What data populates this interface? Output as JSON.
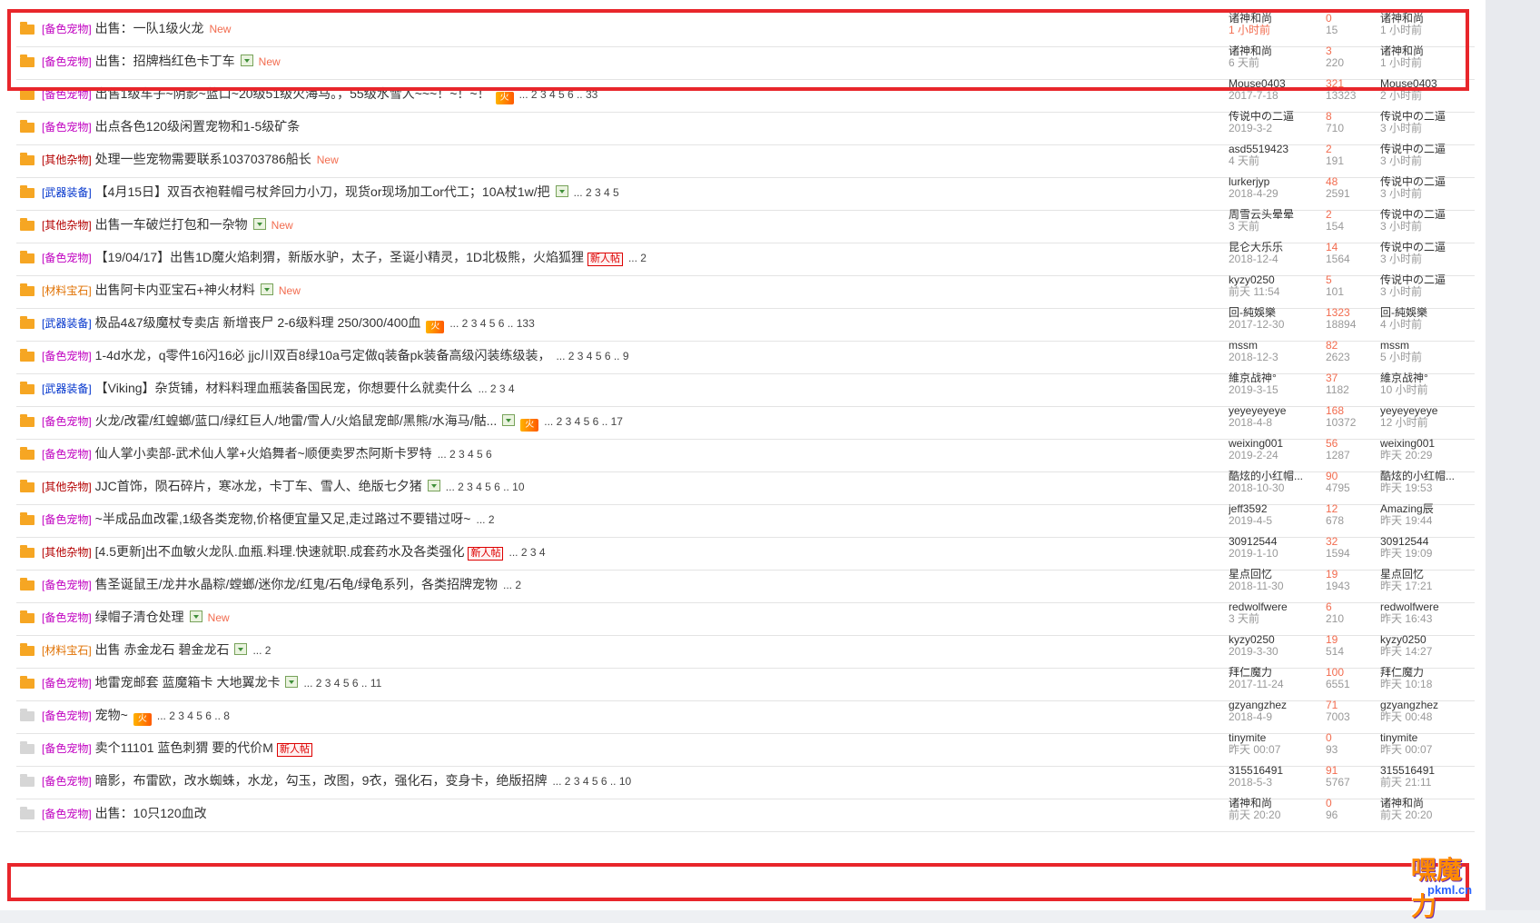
{
  "rows": [
    {
      "icon": "hot",
      "cat": "[备色宠物]",
      "catColor": "#c000c0",
      "title": "出售：一队1级火龙",
      "img": false,
      "hot": false,
      "newbie": false,
      "isNew": true,
      "pages": "",
      "a1": "诸神和尚",
      "a1s": "1 小时前",
      "a1red": true,
      "r": "0",
      "v": "15",
      "a2": "诸神和尚",
      "a2s": "1 小时前"
    },
    {
      "icon": "hot",
      "cat": "[备色宠物]",
      "catColor": "#c000c0",
      "title": "出售：招牌档红色卡丁车",
      "img": true,
      "hot": false,
      "newbie": false,
      "isNew": true,
      "pages": "",
      "a1": "诸神和尚",
      "a1s": "6 天前",
      "a1red": false,
      "r": "3",
      "v": "220",
      "a2": "诸神和尚",
      "a2s": "1 小时前"
    },
    {
      "icon": "hot",
      "cat": "[备色宠物]",
      "catColor": "#c000c0",
      "title": "出售1级车子~阴影~蓝口~20级51级火海马。，55级水雪人~~~！~！~！",
      "img": false,
      "hot": true,
      "newbie": false,
      "isNew": false,
      "pages": "... 2 3 4 5 6 .. 33",
      "a1": "Mouse0403",
      "a1s": "2017-7-18",
      "a1red": false,
      "r": "321",
      "v": "13323",
      "a2": "Mouse0403",
      "a2s": "2 小时前"
    },
    {
      "icon": "hot",
      "cat": "[备色宠物]",
      "catColor": "#c000c0",
      "title": "出点各色120级闲置宠物和1-5级矿条",
      "img": false,
      "hot": false,
      "newbie": false,
      "isNew": false,
      "pages": "",
      "a1": "传说中の二逼",
      "a1s": "2019-3-2",
      "a1red": false,
      "r": "8",
      "v": "710",
      "a2": "传说中の二逼",
      "a2s": "3 小时前"
    },
    {
      "icon": "hot",
      "cat": "[其他杂物]",
      "catColor": "#b40000",
      "title": "处理一些宠物需要联系103703786船长",
      "img": false,
      "hot": false,
      "newbie": false,
      "isNew": true,
      "pages": "",
      "a1": "asd5519423",
      "a1s": "4 天前",
      "a1red": false,
      "r": "2",
      "v": "191",
      "a2": "传说中の二逼",
      "a2s": "3 小时前"
    },
    {
      "icon": "hot",
      "cat": "[武器装备]",
      "catColor": "#0033cc",
      "title": "【4月15日】双百衣袍鞋帽弓杖斧回力小刀，现货or现场加工or代工；10A杖1w/把",
      "img": true,
      "hot": false,
      "newbie": false,
      "isNew": false,
      "pages": "... 2 3 4 5",
      "a1": "lurkerjyp",
      "a1s": "2018-4-29",
      "a1red": false,
      "r": "48",
      "v": "2591",
      "a2": "传说中の二逼",
      "a2s": "3 小时前"
    },
    {
      "icon": "hot",
      "cat": "[其他杂物]",
      "catColor": "#b40000",
      "title": "出售一车破烂打包和一杂物",
      "img": true,
      "hot": false,
      "newbie": false,
      "isNew": true,
      "pages": "",
      "a1": "周雪云头晕晕",
      "a1s": "3 天前",
      "a1red": false,
      "r": "2",
      "v": "154",
      "a2": "传说中の二逼",
      "a2s": "3 小时前"
    },
    {
      "icon": "hot",
      "cat": "[备色宠物]",
      "catColor": "#c000c0",
      "title": "【19/04/17】出售1D魔火焰刺猬，新版水驴，太子，圣诞小精灵，1D北极熊，火焰狐狸",
      "img": false,
      "hot": false,
      "newbie": true,
      "isNew": false,
      "pages": "... 2",
      "a1": "昆仑大乐乐",
      "a1s": "2018-12-4",
      "a1red": false,
      "r": "14",
      "v": "1564",
      "a2": "传说中の二逼",
      "a2s": "3 小时前"
    },
    {
      "icon": "hot",
      "cat": "[材料宝石]",
      "catColor": "#e07000",
      "title": "出售阿卡内亚宝石+神火材料",
      "img": true,
      "hot": false,
      "newbie": false,
      "isNew": true,
      "pages": "",
      "a1": "kyzy0250",
      "a1s": "前天 11:54",
      "a1red": false,
      "r": "5",
      "v": "101",
      "a2": "传说中の二逼",
      "a2s": "3 小时前"
    },
    {
      "icon": "hot",
      "cat": "[武器装备]",
      "catColor": "#0033cc",
      "title": "极品4&7级魔杖专卖店 新增丧尸 2-6级料理 250/300/400血",
      "img": false,
      "hot": true,
      "newbie": false,
      "isNew": false,
      "pages": "... 2 3 4 5 6 .. 133",
      "a1": "回-純娛樂",
      "a1s": "2017-12-30",
      "a1red": false,
      "r": "1323",
      "v": "18894",
      "a2": "回-純娛樂",
      "a2s": "4 小时前"
    },
    {
      "icon": "hot",
      "cat": "[备色宠物]",
      "catColor": "#c000c0",
      "title": "1-4d水龙，q零件16闪16必 jjc川双百8绿10a弓定做q装备pk装备高级闪装练级装，",
      "img": false,
      "hot": false,
      "newbie": false,
      "isNew": false,
      "pages": "... 2 3 4 5 6 .. 9",
      "a1": "mssm",
      "a1s": "2018-12-3",
      "a1red": false,
      "r": "82",
      "v": "2623",
      "a2": "mssm",
      "a2s": "5 小时前"
    },
    {
      "icon": "hot",
      "cat": "[武器装备]",
      "catColor": "#0033cc",
      "title": "【Viking】杂货铺，材料料理血瓶装备国民宠，你想要什么就卖什么",
      "img": false,
      "hot": false,
      "newbie": false,
      "isNew": false,
      "pages": "... 2 3 4",
      "a1": "維京战神°",
      "a1s": "2019-3-15",
      "a1red": false,
      "r": "37",
      "v": "1182",
      "a2": "維京战神°",
      "a2s": "10 小时前"
    },
    {
      "icon": "hot",
      "cat": "[备色宠物]",
      "catColor": "#c000c0",
      "title": "火龙/改霍/红蝗螂/蓝口/绿红巨人/地雷/雪人/火焰鼠宠邮/黑熊/水海马/骷...",
      "img": true,
      "hot": true,
      "newbie": false,
      "isNew": false,
      "pages": "... 2 3 4 5 6 .. 17",
      "a1": "yeyeyeyeye",
      "a1s": "2018-4-8",
      "a1red": false,
      "r": "168",
      "v": "10372",
      "a2": "yeyeyeyeye",
      "a2s": "12 小时前"
    },
    {
      "icon": "hot",
      "cat": "[备色宠物]",
      "catColor": "#c000c0",
      "title": "仙人掌小卖部-武术仙人掌+火焰舞者~顺便卖罗杰阿斯卡罗特",
      "img": false,
      "hot": false,
      "newbie": false,
      "isNew": false,
      "pages": "... 2 3 4 5 6",
      "a1": "weixing001",
      "a1s": "2019-2-24",
      "a1red": false,
      "r": "56",
      "v": "1287",
      "a2": "weixing001",
      "a2s": "昨天 20:29"
    },
    {
      "icon": "hot",
      "cat": "[其他杂物]",
      "catColor": "#b40000",
      "title": "JJC首饰，陨石碎片，寒冰龙，卡丁车、雪人、绝版七夕猪",
      "img": true,
      "hot": false,
      "newbie": false,
      "isNew": false,
      "pages": "... 2 3 4 5 6 .. 10",
      "a1": "酷炫的小红帽...",
      "a1s": "2018-10-30",
      "a1red": false,
      "r": "90",
      "v": "4795",
      "a2": "酷炫的小红帽...",
      "a2s": "昨天 19:53"
    },
    {
      "icon": "hot",
      "cat": "[备色宠物]",
      "catColor": "#c000c0",
      "title": "~半成品血改霍,1级各类宠物,价格便宜量又足,走过路过不要错过呀~",
      "img": false,
      "hot": false,
      "newbie": false,
      "isNew": false,
      "pages": "... 2",
      "a1": "jeff3592",
      "a1s": "2019-4-5",
      "a1red": false,
      "r": "12",
      "v": "678",
      "a2": "Amazing辰",
      "a2s": "昨天 19:44"
    },
    {
      "icon": "hot",
      "cat": "[其他杂物]",
      "catColor": "#b40000",
      "title": "[4.5更新]出不血敏火龙队.血瓶.料理.快速就职.成套药水及各类强化",
      "img": false,
      "hot": false,
      "newbie": true,
      "isNew": false,
      "pages": "... 2 3 4",
      "a1": "30912544",
      "a1s": "2019-1-10",
      "a1red": false,
      "r": "32",
      "v": "1594",
      "a2": "30912544",
      "a2s": "昨天 19:09"
    },
    {
      "icon": "hot",
      "cat": "[备色宠物]",
      "catColor": "#c000c0",
      "title": "售圣诞鼠王/龙井水晶粽/螳螂/迷你龙/红鬼/石龟/绿龟系列，各类招牌宠物",
      "img": false,
      "hot": false,
      "newbie": false,
      "isNew": false,
      "pages": "... 2",
      "a1": "星点回忆",
      "a1s": "2018-11-30",
      "a1red": false,
      "r": "19",
      "v": "1943",
      "a2": "星点回忆",
      "a2s": "昨天 17:21"
    },
    {
      "icon": "hot",
      "cat": "[备色宠物]",
      "catColor": "#c000c0",
      "title": "绿帽子清仓处理",
      "img": true,
      "hot": false,
      "newbie": false,
      "isNew": true,
      "pages": "",
      "a1": "redwolfwere",
      "a1s": "3 天前",
      "a1red": false,
      "r": "6",
      "v": "210",
      "a2": "redwolfwere",
      "a2s": "昨天 16:43"
    },
    {
      "icon": "hot",
      "cat": "[材料宝石]",
      "catColor": "#e07000",
      "title": "出售 赤金龙石 碧金龙石",
      "img": true,
      "hot": false,
      "newbie": false,
      "isNew": false,
      "pages": "... 2",
      "a1": "kyzy0250",
      "a1s": "2019-3-30",
      "a1red": false,
      "r": "19",
      "v": "514",
      "a2": "kyzy0250",
      "a2s": "昨天 14:27"
    },
    {
      "icon": "hot",
      "cat": "[备色宠物]",
      "catColor": "#c000c0",
      "title": "地雷宠邮套 蓝魔箱卡 大地翼龙卡",
      "img": true,
      "hot": false,
      "newbie": false,
      "isNew": false,
      "pages": "... 2 3 4 5 6 .. 11",
      "a1": "拜仁魔力",
      "a1s": "2017-11-24",
      "a1red": false,
      "r": "100",
      "v": "6551",
      "a2": "拜仁魔力",
      "a2s": "昨天 10:18"
    },
    {
      "icon": "plain",
      "cat": "[备色宠物]",
      "catColor": "#c000c0",
      "title": "宠物~",
      "img": false,
      "hot": true,
      "newbie": false,
      "isNew": false,
      "pages": "... 2 3 4 5 6 .. 8",
      "a1": "gzyangzhez",
      "a1s": "2018-4-9",
      "a1red": false,
      "r": "71",
      "v": "7003",
      "a2": "gzyangzhez",
      "a2s": "昨天 00:48"
    },
    {
      "icon": "plain",
      "cat": "[备色宠物]",
      "catColor": "#c000c0",
      "title": "卖个11101 蓝色刺猬 要的代价M",
      "img": false,
      "hot": false,
      "newbie": true,
      "isNew": false,
      "pages": "",
      "a1": "tinymite",
      "a1s": "昨天 00:07",
      "a1red": false,
      "r": "0",
      "v": "93",
      "a2": "tinymite",
      "a2s": "昨天 00:07"
    },
    {
      "icon": "plain",
      "cat": "[备色宠物]",
      "catColor": "#c000c0",
      "title": "暗影，布雷欧，改水蜘蛛，水龙，勾玉，改图，9衣，强化石，变身卡，绝版招牌",
      "img": false,
      "hot": false,
      "newbie": false,
      "isNew": false,
      "pages": "... 2 3 4 5 6 .. 10",
      "a1": "315516491",
      "a1s": "2018-5-3",
      "a1red": false,
      "r": "91",
      "v": "5767",
      "a2": "315516491",
      "a2s": "前天 21:11"
    },
    {
      "icon": "plain",
      "cat": "[备色宠物]",
      "catColor": "#c000c0",
      "title": "出售：10只120血改",
      "img": false,
      "hot": false,
      "newbie": false,
      "isNew": false,
      "pages": "",
      "a1": "诸神和尚",
      "a1s": "前天 20:20",
      "a1red": false,
      "r": "0",
      "v": "96",
      "a2": "诸神和尚",
      "a2s": "前天 20:20"
    }
  ],
  "labels": {
    "new": "New",
    "hot": "火",
    "newbie": "新人帖"
  },
  "watermark": {
    "text": "嘿魔力",
    "url": "pkml.cn"
  }
}
